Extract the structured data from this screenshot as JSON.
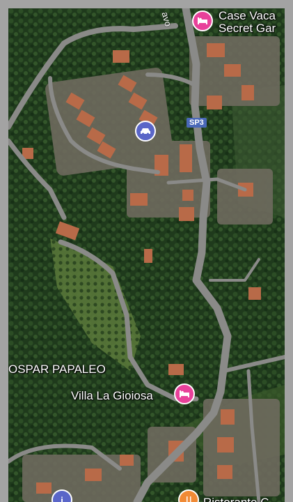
{
  "map": {
    "road_badge": "SP3",
    "road_fragment": "avo",
    "labels": {
      "hotel_top_line1": "Case Vaca",
      "hotel_top_line2": "Secret Gar",
      "place_left": "OSPAR PAPALEO",
      "villa": "Villa La Gioiosa",
      "bottom_partial": "Ristorante C"
    },
    "pins": [
      {
        "type": "hotel",
        "icon": "bed-icon",
        "color": "#e8419a"
      },
      {
        "type": "car",
        "icon": "car-icon",
        "color": "#5a66c8"
      },
      {
        "type": "hotel",
        "icon": "bed-icon",
        "color": "#e8419a"
      },
      {
        "type": "restaurant",
        "icon": "restaurant-icon",
        "color": "#f08a35"
      },
      {
        "type": "info",
        "icon": "info-icon",
        "color": "#5a66c8"
      }
    ]
  }
}
